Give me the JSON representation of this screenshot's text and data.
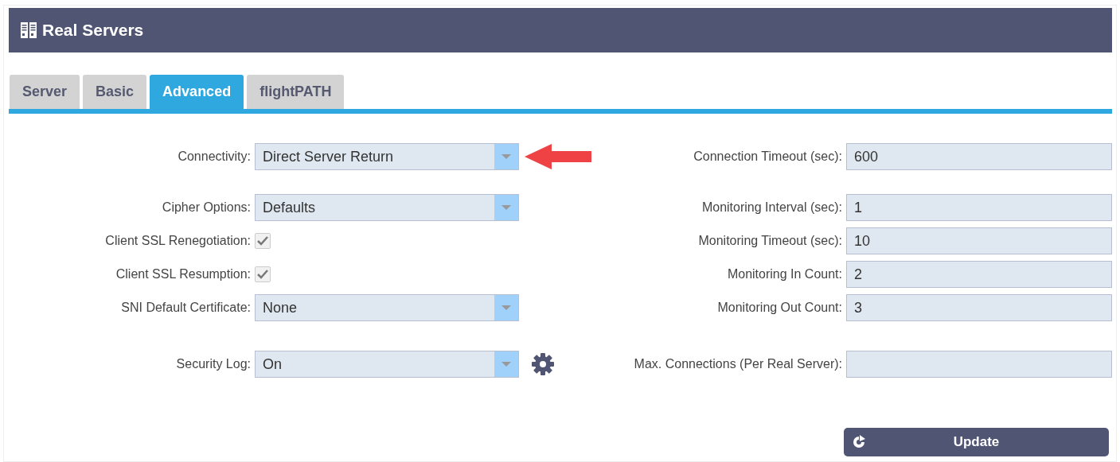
{
  "header": {
    "title": "Real Servers"
  },
  "tabs": [
    {
      "label": "Server",
      "selected": false
    },
    {
      "label": "Basic",
      "selected": false
    },
    {
      "label": "Advanced",
      "selected": true
    },
    {
      "label": "flightPATH",
      "selected": false
    }
  ],
  "left_fields": [
    {
      "kind": "select",
      "label": "Connectivity:",
      "value": "Direct Server Return"
    },
    {
      "kind": "select",
      "label": "Cipher Options:",
      "value": "Defaults"
    },
    {
      "kind": "checkbox",
      "label": "Client SSL Renegotiation:",
      "checked": true
    },
    {
      "kind": "checkbox",
      "label": "Client SSL Resumption:",
      "checked": true
    },
    {
      "kind": "select",
      "label": "SNI Default Certificate:",
      "value": "None"
    },
    {
      "kind": "select",
      "label": "Security Log:",
      "value": "On",
      "settings": true
    }
  ],
  "right_fields": [
    {
      "label": "Connection Timeout (sec):",
      "value": "600"
    },
    {
      "label": "Monitoring Interval (sec):",
      "value": "1"
    },
    {
      "label": "Monitoring Timeout (sec):",
      "value": "10"
    },
    {
      "label": "Monitoring In Count:",
      "value": "2"
    },
    {
      "label": "Monitoring Out Count:",
      "value": "3"
    },
    {
      "label": "Max. Connections (Per Real Server):"
    }
  ],
  "update_button": {
    "label": "Update"
  }
}
